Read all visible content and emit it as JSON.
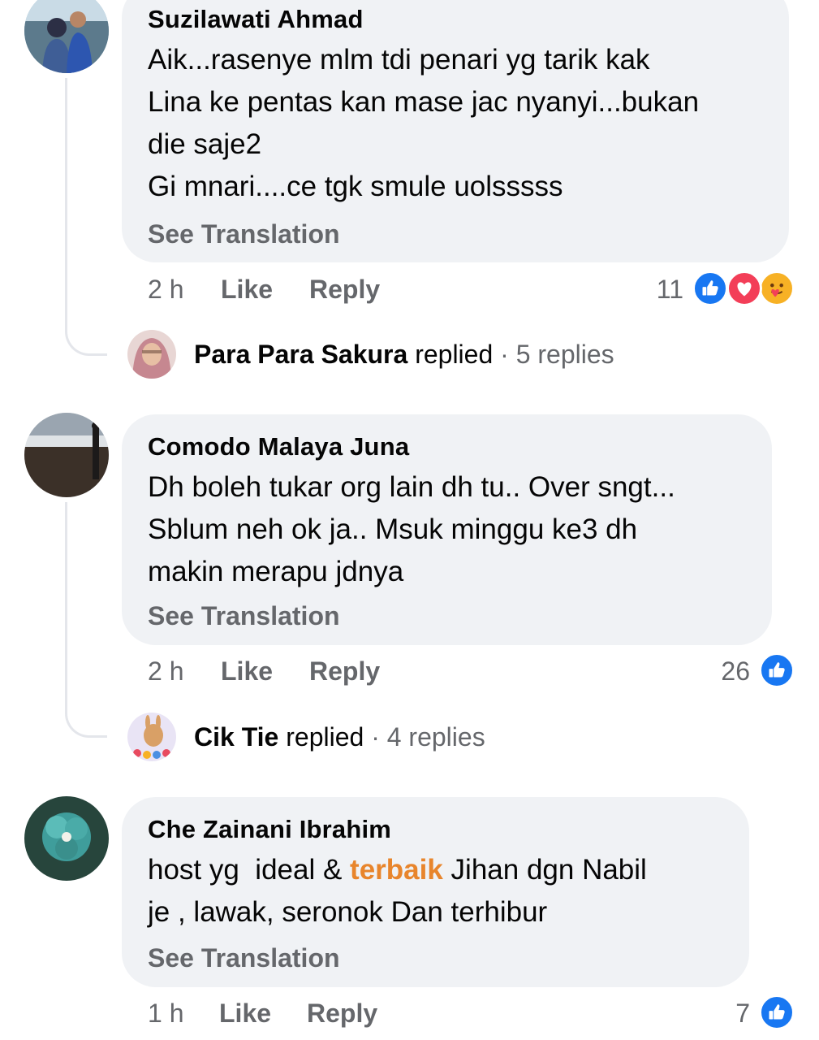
{
  "comments": [
    {
      "author": "Suzilawati Ahmad",
      "lines": [
        "Aik...rasenye mlm tdi penari yg tarik kak",
        "Lina ke pentas kan mase jac nyanyi...bukan",
        "die saje2",
        "Gi mnari....ce tgk smule uolsssss"
      ],
      "see_translation": "See Translation",
      "time": "2 h",
      "like": "Like",
      "reply": "Reply",
      "reaction_count": "11",
      "reactions": [
        "like-icon",
        "love-icon",
        "care-icon"
      ],
      "replied_by": "Para Para Sakura",
      "replied_word": "replied",
      "replies_count": "· 5 replies"
    },
    {
      "author": "Comodo Malaya Juna",
      "lines": [
        "Dh boleh tukar org lain dh tu.. Over sngt...",
        "Sblum neh ok ja.. Msuk minggu ke3 dh",
        "makin merapu jdnya"
      ],
      "see_translation": "See Translation",
      "time": "2 h",
      "like": "Like",
      "reply": "Reply",
      "reaction_count": "26",
      "reactions": [
        "like-icon"
      ],
      "replied_by": "Cik Tie",
      "replied_word": "replied",
      "replies_count": "· 4 replies"
    },
    {
      "author": "Che Zainani Ibrahim",
      "line1_before": "host yg  ideal & ",
      "line1_highlight": "terbaik",
      "line1_after": " Jihan dgn Nabil",
      "line2": "je , lawak, seronok Dan terhibur",
      "see_translation": "See Translation",
      "time": "1 h",
      "like": "Like",
      "reply": "Reply",
      "reaction_count": "7",
      "reactions": [
        "like-icon"
      ]
    }
  ],
  "colors": {
    "bubble": "#f0f2f5",
    "meta": "#65676b",
    "like_blue": "#1877f2",
    "love_red": "#f33e58",
    "care_yellow": "#f7b125",
    "highlight": "#e8852c"
  }
}
